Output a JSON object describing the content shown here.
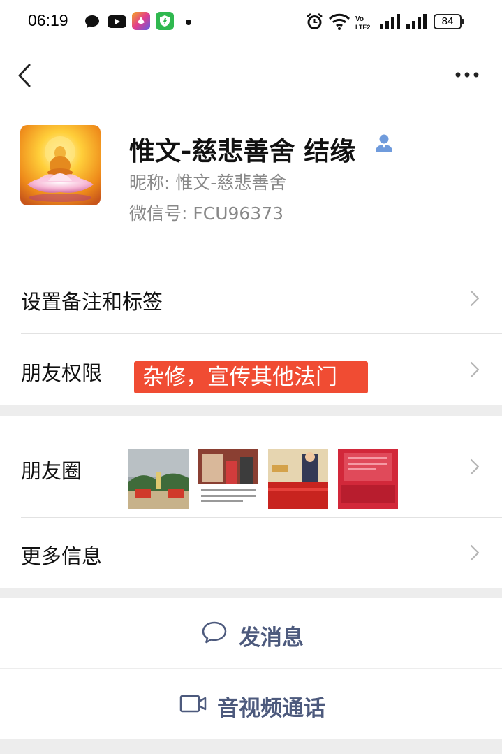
{
  "status_bar": {
    "time": "06:19",
    "battery": "84",
    "left_icons": [
      "message-bubble-icon",
      "youtube-icon",
      "app-shortcut-icon",
      "shield-app-icon",
      "dot-icon"
    ],
    "right_icons": [
      "alarm-icon",
      "wifi-icon",
      "volte-icon",
      "signal-icon",
      "signal-icon-2"
    ]
  },
  "header": {
    "back_icon": "chevron-left-icon",
    "more_icon": "more-dots-icon"
  },
  "profile": {
    "name": "惟文-慈悲善舍 结缘",
    "nickname": "昵称:  惟文-慈悲善舍",
    "wechat_id": "微信号:  FCU96373"
  },
  "rows": {
    "remark_tags": "设置备注和标签",
    "friend_permissions": "朋友权限",
    "annotation": "杂修，宣传其他法门",
    "moments": "朋友圈",
    "more_info": "更多信息"
  },
  "actions": {
    "send_message": "发消息",
    "av_call": "音视频通话"
  },
  "colors": {
    "accent_text": "#4d5a7d",
    "annotation_bg": "#f04c33",
    "user_icon": "#6f9bdc"
  }
}
